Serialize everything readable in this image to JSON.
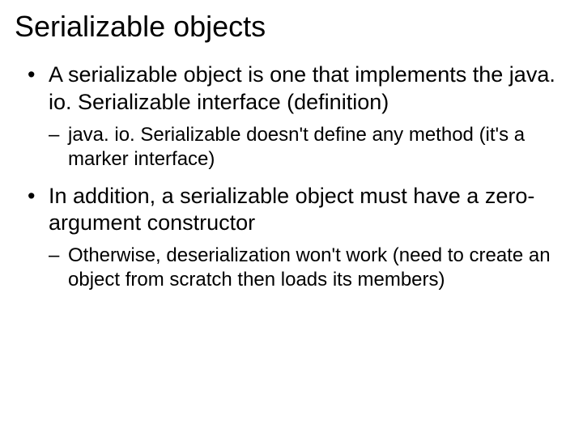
{
  "slide": {
    "title": "Serializable objects",
    "bullets": [
      {
        "text": "A serializable object is one that implements the java. io. Serializable interface (definition)",
        "sub": [
          "java. io. Serializable doesn't define any method (it's a marker interface)"
        ]
      },
      {
        "text": "In addition, a serializable object must have a zero-argument constructor",
        "sub": [
          "Otherwise, deserialization won't work (need to create an object from scratch then loads its members)"
        ]
      }
    ]
  }
}
